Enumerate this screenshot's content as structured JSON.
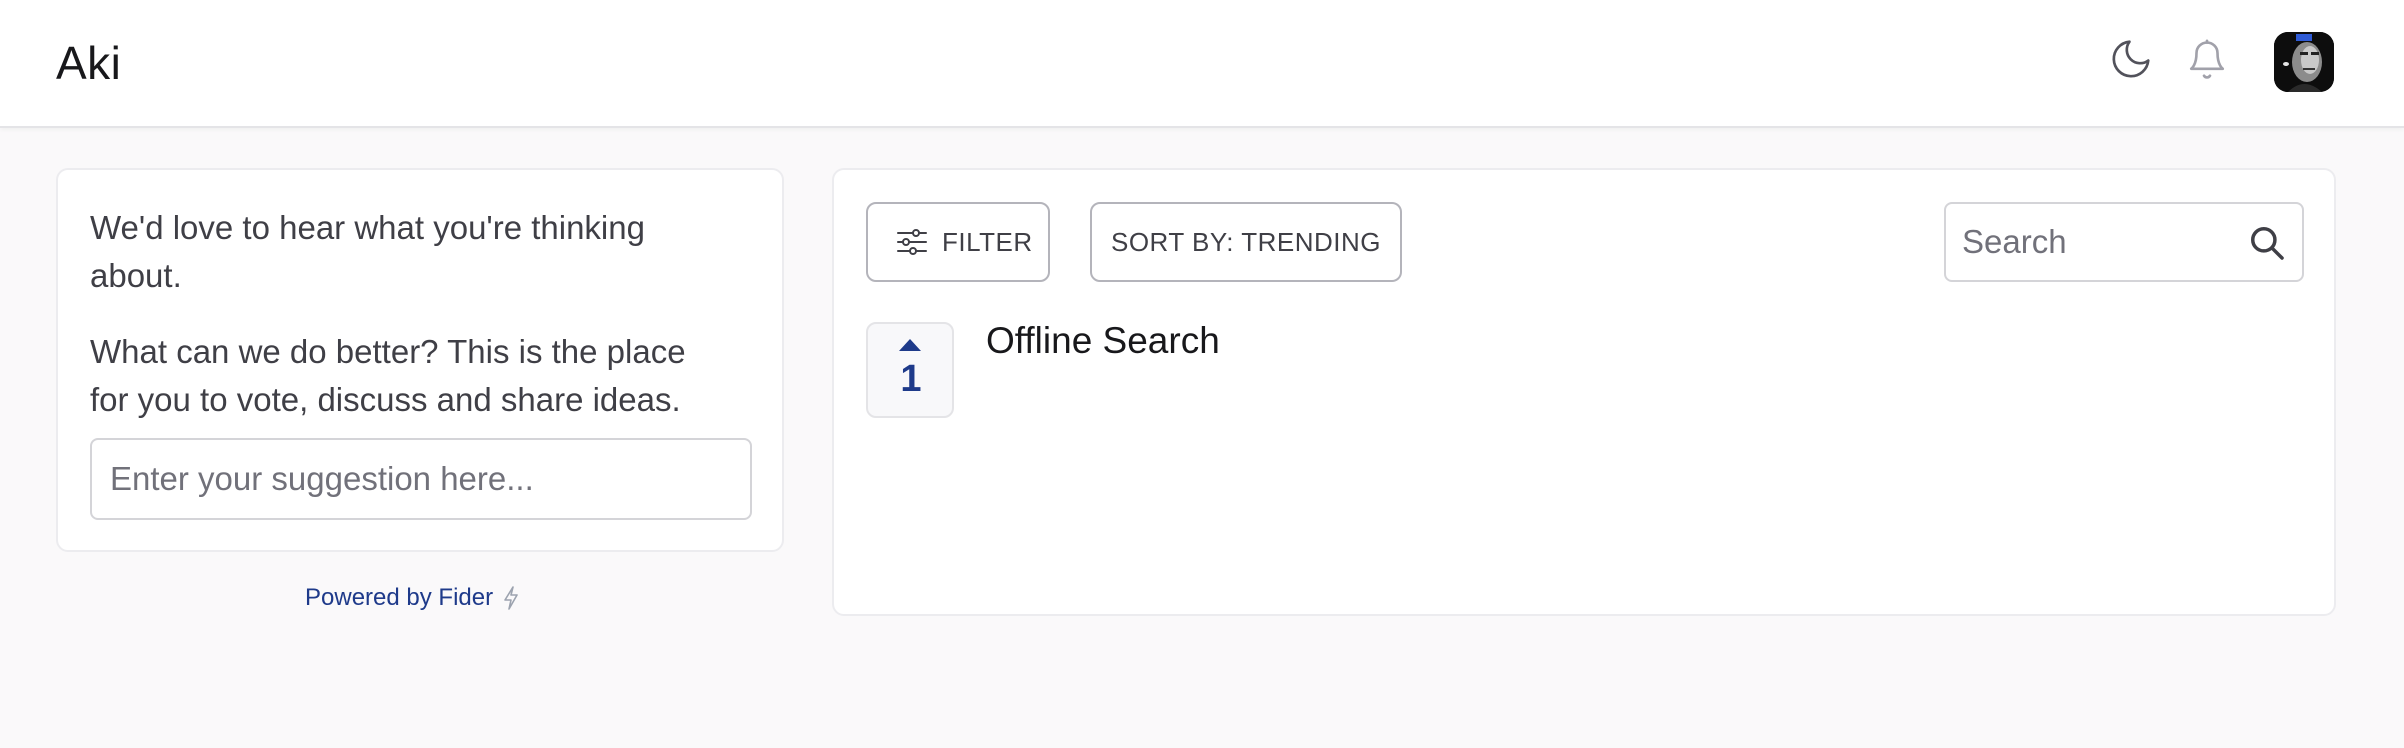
{
  "header": {
    "site_title": "Aki",
    "icons": [
      "moon-icon",
      "bell-icon",
      "user-avatar"
    ]
  },
  "sidebar": {
    "welcome_text": "We'd love to hear what you're thinking about.",
    "description_text": "What can we do better? This is the place for you to vote, discuss and share ideas.",
    "suggestion_placeholder": "Enter your suggestion here...",
    "powered_by": "Powered by Fider"
  },
  "toolbar": {
    "filter_label": "FILTER",
    "sort_label": "SORT BY: TRENDING",
    "search_placeholder": "Search"
  },
  "posts": [
    {
      "votes": "1",
      "title": "Offline Search"
    }
  ],
  "colors": {
    "accent": "#1e3a8a",
    "background": "#faf9fa",
    "card": "#ffffff",
    "border": "#e4e4e7"
  }
}
